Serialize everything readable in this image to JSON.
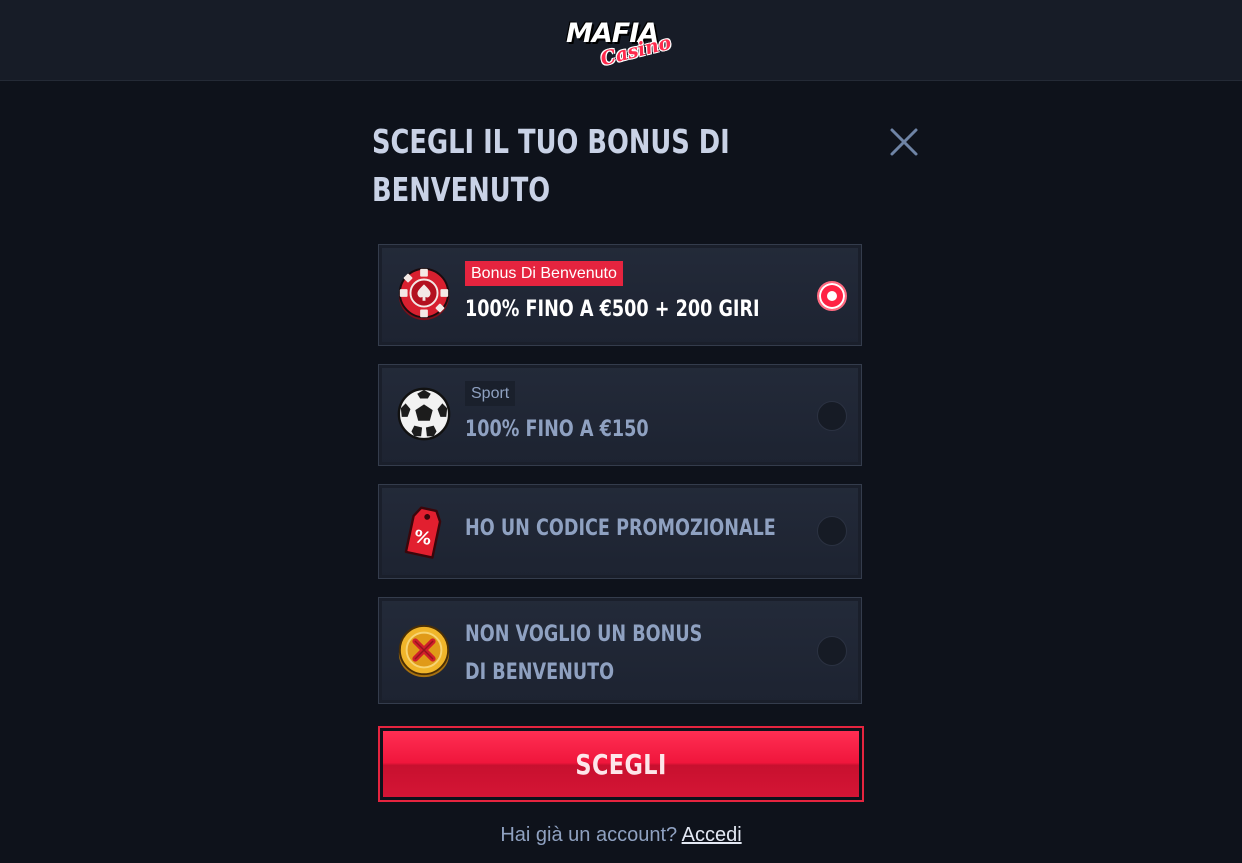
{
  "header": {
    "logo_text": "MAFIA",
    "logo_script": "Casino"
  },
  "modal": {
    "title": "SCEGLI IL TUO BONUS DI BENVENUTO",
    "close_icon": "close-icon"
  },
  "options": [
    {
      "tag": "Bonus Di Benvenuto",
      "label": "100% FINO A €500 + 200 GIRI",
      "icon": "poker-chip-icon",
      "selected": true
    },
    {
      "tag": "Sport",
      "label": "100% FINO A €150",
      "icon": "soccer-ball-icon",
      "selected": false
    },
    {
      "label": "HO UN CODICE PROMOZIONALE",
      "icon": "promo-tag-icon",
      "selected": false
    },
    {
      "label": "NON VOGLIO UN BONUS DI BENVENUTO",
      "icon": "no-bonus-coin-icon",
      "selected": false
    }
  ],
  "cta": {
    "label": "SCEGLI"
  },
  "footer": {
    "question": "Hai già un account?",
    "link": "Accedi"
  },
  "colors": {
    "accent": "#e5243f",
    "background": "#0e121b",
    "card": "#232a39",
    "muted_text": "#8fa1c1"
  }
}
